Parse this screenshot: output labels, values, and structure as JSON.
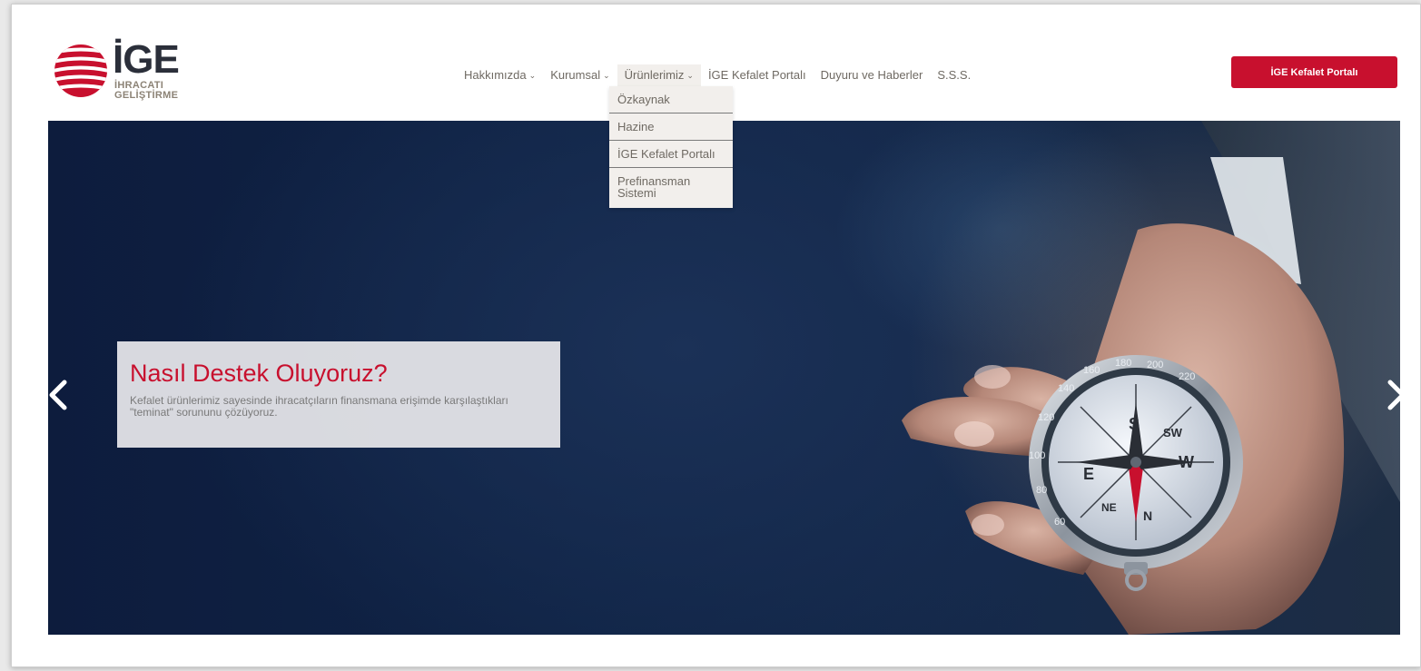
{
  "logo": {
    "word": "İGE",
    "line1": "İHRACATI",
    "line2": "GELİŞTİRME"
  },
  "nav": {
    "items": [
      {
        "label": "Hakkımızda",
        "caret": "⌄"
      },
      {
        "label": "Kurumsal",
        "caret": "⌄"
      },
      {
        "label": "Ürünlerimiz",
        "caret": "⌄"
      },
      {
        "label": "İGE Kefalet Portalı"
      },
      {
        "label": "Duyuru ve Haberler"
      },
      {
        "label": "S.S.S."
      }
    ],
    "dropdown": [
      "Özkaynak",
      "Hazine",
      "İGE Kefalet Portalı",
      "Prefinansman Sistemi"
    ]
  },
  "cta": {
    "label": "İGE Kefalet Portalı"
  },
  "hero": {
    "title": "Nasıl Destek Oluyoruz?",
    "text": "Kefalet ürünlerimiz sayesinde ihracatçıların finansmana erişimde karşılaştıkları \"teminat\" sorununu çözüyoruz.",
    "compass": {
      "n1": "120",
      "n2": "140",
      "n3": "160",
      "n4": "180",
      "n5": "200",
      "n6": "220",
      "n7": "100",
      "n8": "80",
      "n9": "60",
      "dS": "S",
      "dSW": "SW",
      "dE": "E",
      "dW": "W",
      "dNE": "NE",
      "dN": "N"
    }
  },
  "icons": {
    "prev": "chevron-left-icon",
    "next": "chevron-right-icon"
  },
  "colors": {
    "brand_red": "#c8102e",
    "nav_text": "#6f6a63",
    "hero_bg": "#102446"
  }
}
